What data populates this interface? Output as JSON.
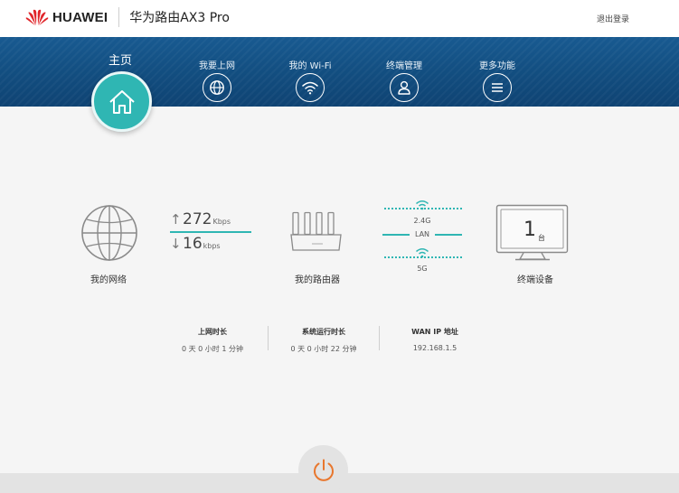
{
  "header": {
    "brand": "HUAWEI",
    "product": "华为路由AX3 Pro",
    "logout": "退出登录"
  },
  "nav": {
    "home": {
      "label": "主页",
      "icon": "home-icon"
    },
    "items": [
      {
        "label": "我要上网",
        "icon": "globe-icon"
      },
      {
        "label": "我的 Wi-Fi",
        "icon": "wifi-icon"
      },
      {
        "label": "终端管理",
        "icon": "user-icon"
      },
      {
        "label": "更多功能",
        "icon": "menu-icon"
      }
    ]
  },
  "network": {
    "caption": "我的网络",
    "upload_value": "272",
    "upload_unit": "Kbps",
    "download_value": "16",
    "download_unit": "kbps"
  },
  "router": {
    "caption": "我的路由器",
    "band_24": "2.4G",
    "lan": "LAN",
    "band_5": "5G"
  },
  "devices": {
    "count": "1",
    "unit": "台",
    "caption": "终端设备"
  },
  "stats": [
    {
      "title": "上网时长",
      "value": "0 天 0 小时 1 分钟"
    },
    {
      "title": "系统运行时长",
      "value": "0 天 0 小时 22 分钟"
    },
    {
      "title": "WAN IP 地址",
      "value": "192.168.1.5"
    }
  ],
  "colors": {
    "accent": "#2fb6b3",
    "nav_bg": "#124d7f",
    "brand_red": "#e0262b",
    "power": "#e8772e"
  }
}
